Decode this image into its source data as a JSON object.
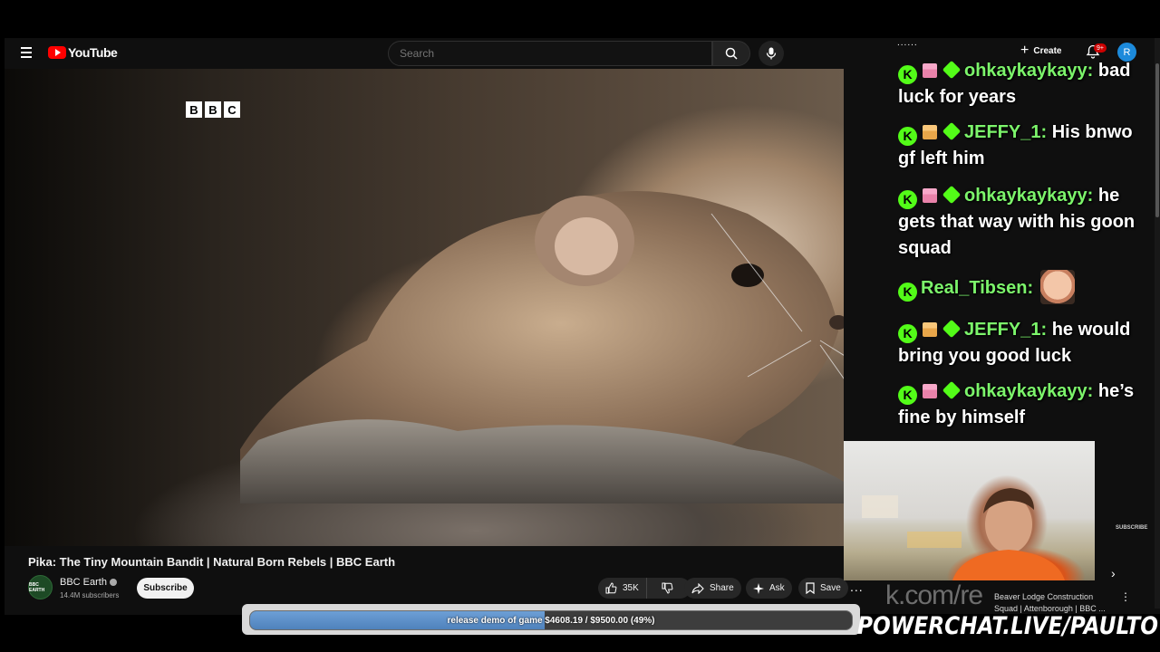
{
  "header": {
    "logo_text": "YouTube",
    "search_placeholder": "Search",
    "create_label": "Create",
    "notification_badge": "9+",
    "user_initial": "R"
  },
  "video": {
    "watermark": [
      "B",
      "B",
      "C"
    ],
    "title": "Pika: The Tiny Mountain Bandit | Natural Born Rebels | BBC Earth"
  },
  "channel": {
    "name": "BBC Earth",
    "avatar_text": "BBC EARTH",
    "subscribers": "14.4M subscribers",
    "subscribe_label": "Subscribe"
  },
  "actions": {
    "like_count": "35K",
    "share_label": "Share",
    "ask_label": "Ask",
    "save_label": "Save",
    "more_label": "..."
  },
  "chat": {
    "top_fragment": "......",
    "messages": [
      {
        "user": "ohkaykaykayy:",
        "text": "bad luck for years",
        "gift": "pink"
      },
      {
        "user": "JEFFY_1:",
        "text": "His bnwo gf left him",
        "gift": "orange"
      },
      {
        "user": "ohkaykaykayy:",
        "text": "he gets that way with his goon squad",
        "gift": "pink"
      },
      {
        "user": "Real_Tibsen:",
        "text": "",
        "gift": "none",
        "emote": "face-emote"
      },
      {
        "user": "JEFFY_1:",
        "text": "he would bring you good luck",
        "gift": "orange"
      },
      {
        "user": "ohkaykaykayy:",
        "text": "he’s fine by himself",
        "gift": "pink"
      }
    ],
    "badge_letter": "K",
    "accent_color": "#53fc18"
  },
  "sidebar": {
    "subscribe_watermark": "SUBSCRIBE",
    "overlay_url": "k.com/re",
    "rec_title": "Beaver Lodge Construction Squad | Attenborough | BBC ...",
    "rec_more": "⋮",
    "next_arrow": "›"
  },
  "donation": {
    "text": "release demo of game $4608.19 / $9500.00 (49%)",
    "progress_percent": 49,
    "fill_color": "#5a8fca"
  },
  "branding": {
    "powerchat": "POWERCHAT.LIVE/PAULTOWN"
  }
}
